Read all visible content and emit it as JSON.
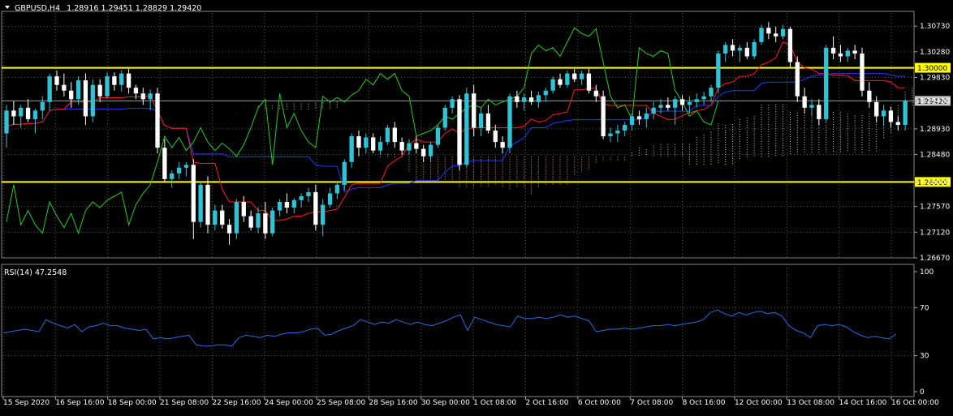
{
  "header": {
    "symbol": "GBPUSD,H4",
    "ohlc": "1.28916 1.29451 1.28829 1.29420"
  },
  "rsi_label": "RSI(14) 47.2548",
  "colors": {
    "background": "#000000",
    "grid": "#5a5a5a",
    "bull_candle": "#2ec4d6",
    "bear_candle": "#ffffff",
    "tenkan": "#ff1a1a",
    "kijun": "#1c3cff",
    "chikou": "#22cc22",
    "cloud_a": "#e0a080",
    "cloud_b": "#cccccc",
    "level_line": "#ffff00",
    "level_label_bg": "#ffff00",
    "current_price_bg": "#c8c8c8",
    "rsi_line": "#2a6cdc",
    "axis_text": "#ffffff"
  },
  "chart_data": [
    {
      "type": "candlestick",
      "title": "GBPUSD,H4",
      "ylim": [
        1.2667,
        1.3096
      ],
      "yticks": [
        "1.30730",
        "1.30280",
        "1.29830",
        "1.29420",
        "1.28930",
        "1.28480",
        "1.28000",
        "1.27570",
        "1.27120",
        "1.26670"
      ],
      "current_price": "1.29420",
      "levels": [
        {
          "label": "1.30000",
          "value": 1.3
        },
        {
          "label": "1.28000",
          "value": 1.28
        }
      ],
      "x_labels": [
        "15 Sep 2020",
        "16 Sep 16:00",
        "18 Sep 00:00",
        "21 Sep 08:00",
        "22 Sep 16:00",
        "24 Sep 00:00",
        "25 Sep 08:00",
        "28 Sep 16:00",
        "30 Sep 00:00",
        "1 Oct 08:00",
        "2 Oct 16:00",
        "6 Oct 00:00",
        "7 Oct 08:00",
        "8 Oct 16:00",
        "12 Oct 00:00",
        "13 Oct 08:00",
        "14 Oct 16:00",
        "16 Oct 00:00"
      ],
      "candles": [
        {
          "o": 1.2885,
          "h": 1.2935,
          "l": 1.286,
          "c": 1.2925
        },
        {
          "o": 1.2925,
          "h": 1.2942,
          "l": 1.29,
          "c": 1.2915
        },
        {
          "o": 1.2915,
          "h": 1.2935,
          "l": 1.2895,
          "c": 1.293
        },
        {
          "o": 1.293,
          "h": 1.2945,
          "l": 1.2905,
          "c": 1.291
        },
        {
          "o": 1.291,
          "h": 1.2928,
          "l": 1.2885,
          "c": 1.2925
        },
        {
          "o": 1.2925,
          "h": 1.295,
          "l": 1.291,
          "c": 1.294
        },
        {
          "o": 1.294,
          "h": 1.299,
          "l": 1.2925,
          "c": 1.2985
        },
        {
          "o": 1.2985,
          "h": 1.2995,
          "l": 1.296,
          "c": 1.297
        },
        {
          "o": 1.297,
          "h": 1.299,
          "l": 1.295,
          "c": 1.296
        },
        {
          "o": 1.296,
          "h": 1.2975,
          "l": 1.293,
          "c": 1.2945
        },
        {
          "o": 1.2945,
          "h": 1.2985,
          "l": 1.2935,
          "c": 1.2978
        },
        {
          "o": 1.2978,
          "h": 1.299,
          "l": 1.29,
          "c": 1.2915
        },
        {
          "o": 1.2915,
          "h": 1.298,
          "l": 1.2905,
          "c": 1.297
        },
        {
          "o": 1.297,
          "h": 1.298,
          "l": 1.294,
          "c": 1.295
        },
        {
          "o": 1.295,
          "h": 1.2992,
          "l": 1.2945,
          "c": 1.2985
        },
        {
          "o": 1.2985,
          "h": 1.2992,
          "l": 1.296,
          "c": 1.297
        },
        {
          "o": 1.297,
          "h": 1.2995,
          "l": 1.2958,
          "c": 1.299
        },
        {
          "o": 1.299,
          "h": 1.2998,
          "l": 1.2955,
          "c": 1.2965
        },
        {
          "o": 1.2965,
          "h": 1.297,
          "l": 1.2945,
          "c": 1.2955
        },
        {
          "o": 1.2955,
          "h": 1.2965,
          "l": 1.2935,
          "c": 1.2945
        },
        {
          "o": 1.2945,
          "h": 1.2962,
          "l": 1.2925,
          "c": 1.2955
        },
        {
          "o": 1.2955,
          "h": 1.2965,
          "l": 1.285,
          "c": 1.286
        },
        {
          "o": 1.286,
          "h": 1.2875,
          "l": 1.28,
          "c": 1.2805
        },
        {
          "o": 1.2805,
          "h": 1.282,
          "l": 1.279,
          "c": 1.2815
        },
        {
          "o": 1.2815,
          "h": 1.2835,
          "l": 1.2805,
          "c": 1.2825
        },
        {
          "o": 1.2825,
          "h": 1.2835,
          "l": 1.281,
          "c": 1.283
        },
        {
          "o": 1.283,
          "h": 1.284,
          "l": 1.27,
          "c": 1.273
        },
        {
          "o": 1.273,
          "h": 1.28,
          "l": 1.272,
          "c": 1.2795
        },
        {
          "o": 1.2795,
          "h": 1.281,
          "l": 1.271,
          "c": 1.2725
        },
        {
          "o": 1.2725,
          "h": 1.276,
          "l": 1.2715,
          "c": 1.275
        },
        {
          "o": 1.275,
          "h": 1.276,
          "l": 1.2718,
          "c": 1.2725
        },
        {
          "o": 1.2725,
          "h": 1.2735,
          "l": 1.269,
          "c": 1.271
        },
        {
          "o": 1.271,
          "h": 1.277,
          "l": 1.27,
          "c": 1.2765
        },
        {
          "o": 1.2765,
          "h": 1.2775,
          "l": 1.273,
          "c": 1.274
        },
        {
          "o": 1.274,
          "h": 1.275,
          "l": 1.2715,
          "c": 1.272
        },
        {
          "o": 1.272,
          "h": 1.2755,
          "l": 1.271,
          "c": 1.2745
        },
        {
          "o": 1.2745,
          "h": 1.2765,
          "l": 1.27,
          "c": 1.271
        },
        {
          "o": 1.271,
          "h": 1.2755,
          "l": 1.2705,
          "c": 1.275
        },
        {
          "o": 1.275,
          "h": 1.277,
          "l": 1.274,
          "c": 1.2765
        },
        {
          "o": 1.2765,
          "h": 1.278,
          "l": 1.2745,
          "c": 1.2755
        },
        {
          "o": 1.2755,
          "h": 1.2772,
          "l": 1.2745,
          "c": 1.2768
        },
        {
          "o": 1.2768,
          "h": 1.278,
          "l": 1.2755,
          "c": 1.2775
        },
        {
          "o": 1.2775,
          "h": 1.279,
          "l": 1.2765,
          "c": 1.2782
        },
        {
          "o": 1.2782,
          "h": 1.2795,
          "l": 1.2715,
          "c": 1.2725
        },
        {
          "o": 1.2725,
          "h": 1.277,
          "l": 1.2705,
          "c": 1.276
        },
        {
          "o": 1.276,
          "h": 1.279,
          "l": 1.2755,
          "c": 1.278
        },
        {
          "o": 1.278,
          "h": 1.28,
          "l": 1.277,
          "c": 1.2795
        },
        {
          "o": 1.2795,
          "h": 1.284,
          "l": 1.2785,
          "c": 1.2835
        },
        {
          "o": 1.2835,
          "h": 1.2885,
          "l": 1.2825,
          "c": 1.288
        },
        {
          "o": 1.288,
          "h": 1.289,
          "l": 1.2845,
          "c": 1.286
        },
        {
          "o": 1.286,
          "h": 1.2885,
          "l": 1.285,
          "c": 1.2878
        },
        {
          "o": 1.2878,
          "h": 1.2885,
          "l": 1.285,
          "c": 1.2855
        },
        {
          "o": 1.2855,
          "h": 1.288,
          "l": 1.2848,
          "c": 1.287
        },
        {
          "o": 1.287,
          "h": 1.29,
          "l": 1.2865,
          "c": 1.2895
        },
        {
          "o": 1.2895,
          "h": 1.2905,
          "l": 1.286,
          "c": 1.287
        },
        {
          "o": 1.287,
          "h": 1.2878,
          "l": 1.2848,
          "c": 1.2855
        },
        {
          "o": 1.2855,
          "h": 1.2875,
          "l": 1.2848,
          "c": 1.2868
        },
        {
          "o": 1.2868,
          "h": 1.288,
          "l": 1.285,
          "c": 1.2858
        },
        {
          "o": 1.2858,
          "h": 1.2865,
          "l": 1.2835,
          "c": 1.2845
        },
        {
          "o": 1.2845,
          "h": 1.287,
          "l": 1.2835,
          "c": 1.2865
        },
        {
          "o": 1.2865,
          "h": 1.29,
          "l": 1.286,
          "c": 1.2895
        },
        {
          "o": 1.2895,
          "h": 1.2935,
          "l": 1.289,
          "c": 1.293
        },
        {
          "o": 1.293,
          "h": 1.295,
          "l": 1.292,
          "c": 1.2945
        },
        {
          "o": 1.2945,
          "h": 1.2952,
          "l": 1.282,
          "c": 1.283
        },
        {
          "o": 1.283,
          "h": 1.2965,
          "l": 1.2825,
          "c": 1.2955
        },
        {
          "o": 1.2955,
          "h": 1.297,
          "l": 1.288,
          "c": 1.2895
        },
        {
          "o": 1.2895,
          "h": 1.293,
          "l": 1.288,
          "c": 1.292
        },
        {
          "o": 1.292,
          "h": 1.2935,
          "l": 1.2885,
          "c": 1.289
        },
        {
          "o": 1.289,
          "h": 1.29,
          "l": 1.286,
          "c": 1.287
        },
        {
          "o": 1.287,
          "h": 1.288,
          "l": 1.285,
          "c": 1.286
        },
        {
          "o": 1.286,
          "h": 1.2955,
          "l": 1.285,
          "c": 1.295
        },
        {
          "o": 1.295,
          "h": 1.296,
          "l": 1.293,
          "c": 1.294
        },
        {
          "o": 1.294,
          "h": 1.2955,
          "l": 1.2925,
          "c": 1.2948
        },
        {
          "o": 1.2948,
          "h": 1.296,
          "l": 1.2935,
          "c": 1.294
        },
        {
          "o": 1.294,
          "h": 1.2958,
          "l": 1.293,
          "c": 1.2952
        },
        {
          "o": 1.2952,
          "h": 1.2965,
          "l": 1.294,
          "c": 1.296
        },
        {
          "o": 1.296,
          "h": 1.2985,
          "l": 1.2955,
          "c": 1.298
        },
        {
          "o": 1.298,
          "h": 1.299,
          "l": 1.2965,
          "c": 1.297
        },
        {
          "o": 1.297,
          "h": 1.2995,
          "l": 1.2965,
          "c": 1.299
        },
        {
          "o": 1.299,
          "h": 1.2998,
          "l": 1.2975,
          "c": 1.298
        },
        {
          "o": 1.298,
          "h": 1.2995,
          "l": 1.297,
          "c": 1.299
        },
        {
          "o": 1.299,
          "h": 1.2998,
          "l": 1.2955,
          "c": 1.296
        },
        {
          "o": 1.296,
          "h": 1.297,
          "l": 1.294,
          "c": 1.295
        },
        {
          "o": 1.295,
          "h": 1.296,
          "l": 1.2875,
          "c": 1.288
        },
        {
          "o": 1.288,
          "h": 1.2895,
          "l": 1.287,
          "c": 1.2885
        },
        {
          "o": 1.2885,
          "h": 1.29,
          "l": 1.287,
          "c": 1.289
        },
        {
          "o": 1.289,
          "h": 1.2905,
          "l": 1.288,
          "c": 1.29
        },
        {
          "o": 1.29,
          "h": 1.292,
          "l": 1.289,
          "c": 1.2915
        },
        {
          "o": 1.2915,
          "h": 1.2925,
          "l": 1.29,
          "c": 1.291
        },
        {
          "o": 1.291,
          "h": 1.293,
          "l": 1.2895,
          "c": 1.292
        },
        {
          "o": 1.292,
          "h": 1.294,
          "l": 1.291,
          "c": 1.293
        },
        {
          "o": 1.293,
          "h": 1.2945,
          "l": 1.292,
          "c": 1.2935
        },
        {
          "o": 1.2935,
          "h": 1.2948,
          "l": 1.2925,
          "c": 1.293
        },
        {
          "o": 1.293,
          "h": 1.295,
          "l": 1.29,
          "c": 1.2945
        },
        {
          "o": 1.2945,
          "h": 1.2952,
          "l": 1.2925,
          "c": 1.2935
        },
        {
          "o": 1.2935,
          "h": 1.295,
          "l": 1.292,
          "c": 1.294
        },
        {
          "o": 1.294,
          "h": 1.2955,
          "l": 1.293,
          "c": 1.2945
        },
        {
          "o": 1.2945,
          "h": 1.2958,
          "l": 1.2935,
          "c": 1.295
        },
        {
          "o": 1.295,
          "h": 1.297,
          "l": 1.294,
          "c": 1.2965
        },
        {
          "o": 1.2965,
          "h": 1.303,
          "l": 1.2955,
          "c": 1.3025
        },
        {
          "o": 1.3025,
          "h": 1.3045,
          "l": 1.301,
          "c": 1.304
        },
        {
          "o": 1.304,
          "h": 1.305,
          "l": 1.302,
          "c": 1.303
        },
        {
          "o": 1.303,
          "h": 1.304,
          "l": 1.301,
          "c": 1.3035
        },
        {
          "o": 1.3035,
          "h": 1.3045,
          "l": 1.3015,
          "c": 1.302
        },
        {
          "o": 1.302,
          "h": 1.305,
          "l": 1.3015,
          "c": 1.3045
        },
        {
          "o": 1.3045,
          "h": 1.3075,
          "l": 1.304,
          "c": 1.307
        },
        {
          "o": 1.307,
          "h": 1.308,
          "l": 1.305,
          "c": 1.306
        },
        {
          "o": 1.306,
          "h": 1.3072,
          "l": 1.3045,
          "c": 1.3055
        },
        {
          "o": 1.3055,
          "h": 1.3075,
          "l": 1.305,
          "c": 1.3068
        },
        {
          "o": 1.3068,
          "h": 1.3072,
          "l": 1.3,
          "c": 1.301
        },
        {
          "o": 1.301,
          "h": 1.302,
          "l": 1.294,
          "c": 1.295
        },
        {
          "o": 1.295,
          "h": 1.2965,
          "l": 1.292,
          "c": 1.293
        },
        {
          "o": 1.293,
          "h": 1.2945,
          "l": 1.2915,
          "c": 1.2935
        },
        {
          "o": 1.2935,
          "h": 1.2945,
          "l": 1.29,
          "c": 1.291
        },
        {
          "o": 1.291,
          "h": 1.304,
          "l": 1.2905,
          "c": 1.3035
        },
        {
          "o": 1.3035,
          "h": 1.3055,
          "l": 1.3015,
          "c": 1.3025
        },
        {
          "o": 1.3025,
          "h": 1.304,
          "l": 1.301,
          "c": 1.302
        },
        {
          "o": 1.302,
          "h": 1.3035,
          "l": 1.301,
          "c": 1.303
        },
        {
          "o": 1.303,
          "h": 1.304,
          "l": 1.3015,
          "c": 1.3025
        },
        {
          "o": 1.3025,
          "h": 1.3035,
          "l": 1.295,
          "c": 1.296
        },
        {
          "o": 1.296,
          "h": 1.2975,
          "l": 1.293,
          "c": 1.294
        },
        {
          "o": 1.294,
          "h": 1.295,
          "l": 1.2905,
          "c": 1.2915
        },
        {
          "o": 1.2915,
          "h": 1.2935,
          "l": 1.29,
          "c": 1.2925
        },
        {
          "o": 1.2925,
          "h": 1.2932,
          "l": 1.2895,
          "c": 1.2905
        },
        {
          "o": 1.2905,
          "h": 1.2915,
          "l": 1.289,
          "c": 1.29
        },
        {
          "o": 1.29,
          "h": 1.2945,
          "l": 1.289,
          "c": 1.2942
        }
      ],
      "rsi": {
        "label": "RSI(14) 47.2548",
        "ylim": [
          0,
          100
        ],
        "yticks": [
          "100",
          "70",
          "30",
          "0"
        ],
        "values": [
          49,
          50,
          51,
          52,
          51,
          50,
          60,
          57,
          55,
          53,
          56,
          50,
          54,
          55,
          57,
          55,
          55,
          53,
          52,
          51,
          52,
          44,
          45,
          44,
          45,
          46,
          47,
          39,
          38,
          38,
          39,
          39,
          38,
          45,
          47,
          46,
          45,
          47,
          46,
          48,
          49,
          49,
          50,
          52,
          53,
          47,
          48,
          51,
          53,
          55,
          60,
          58,
          56,
          58,
          57,
          60,
          58,
          56,
          58,
          56,
          55,
          57,
          59,
          62,
          64,
          51,
          62,
          60,
          58,
          56,
          55,
          54,
          63,
          61,
          61,
          62,
          61,
          62,
          64,
          62,
          63,
          61,
          59,
          50,
          51,
          52,
          52,
          53,
          52,
          53,
          54,
          55,
          55,
          56,
          55,
          56,
          57,
          58,
          60,
          66,
          68,
          65,
          63,
          66,
          64,
          66,
          67,
          65,
          66,
          63,
          55,
          51,
          49,
          45,
          55,
          56,
          55,
          56,
          54,
          50,
          47,
          45,
          46,
          45,
          44,
          48
        ]
      }
    }
  ]
}
